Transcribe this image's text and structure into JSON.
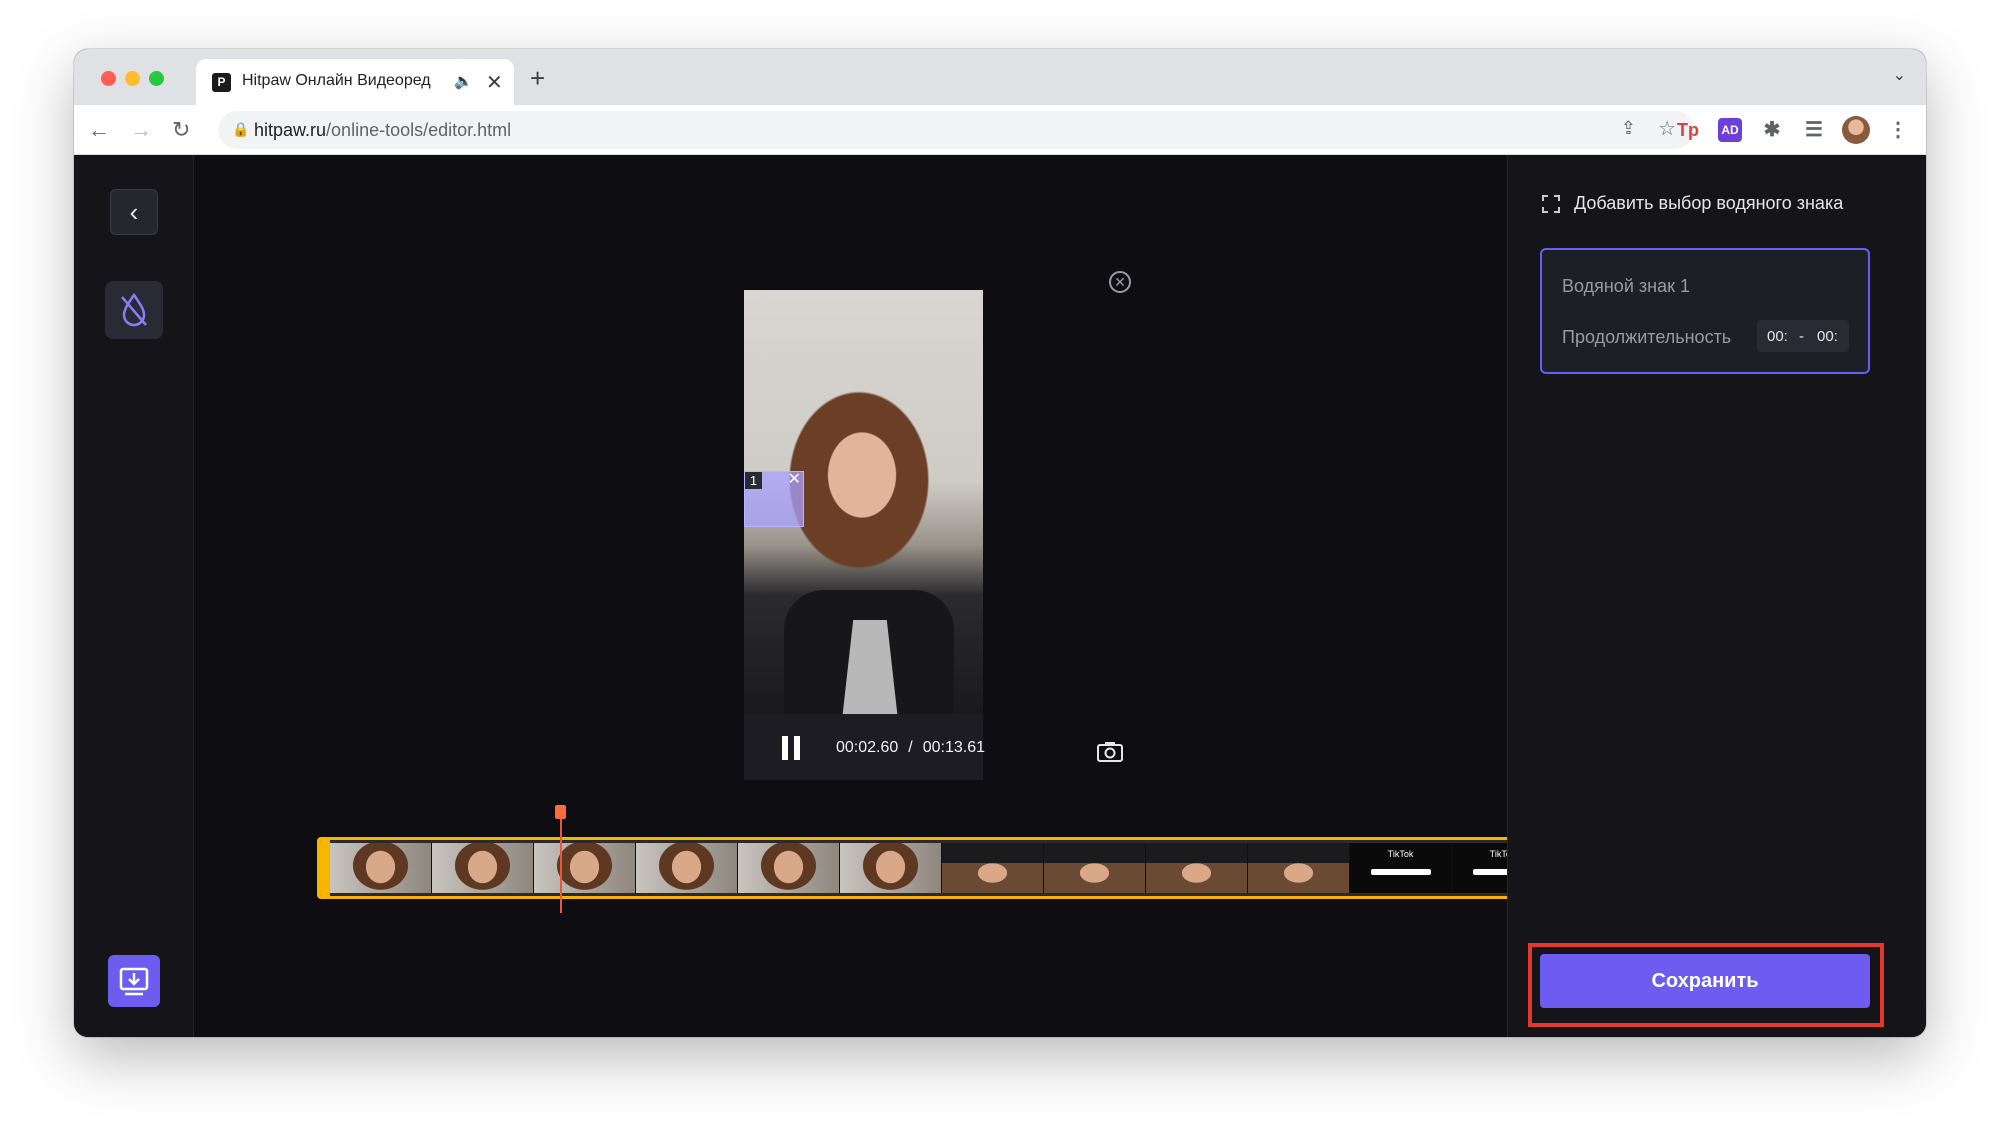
{
  "browser": {
    "tab_title": "Hitpaw Онлайн Видеоред",
    "favicon_text": "P",
    "new_tab_icon": "+",
    "url_domain": "hitpaw.ru",
    "url_path": "/online-tools/editor.html",
    "ext_tp_label": "Tp",
    "ext_ad_label": "AD"
  },
  "right_panel": {
    "add_watermark_label": "Добавить выбор водяного знака",
    "watermark_name": "Водяной знак 1",
    "duration_label": "Продолжительность",
    "range_start": "00:",
    "range_separator": "-",
    "range_end": "00:",
    "save_label": "Сохранить"
  },
  "player": {
    "current_time": "00:02.60",
    "separator": "/",
    "total_time": "00:13.61",
    "watermark_index": "1",
    "progress_fraction": 0.19
  },
  "timeline": {
    "tiktok_label": "TikTok"
  },
  "colors": {
    "accent": "#6e5cf0",
    "timeline_border": "#f7b500",
    "playhead": "#e8593a",
    "highlight": "#e2392c"
  }
}
